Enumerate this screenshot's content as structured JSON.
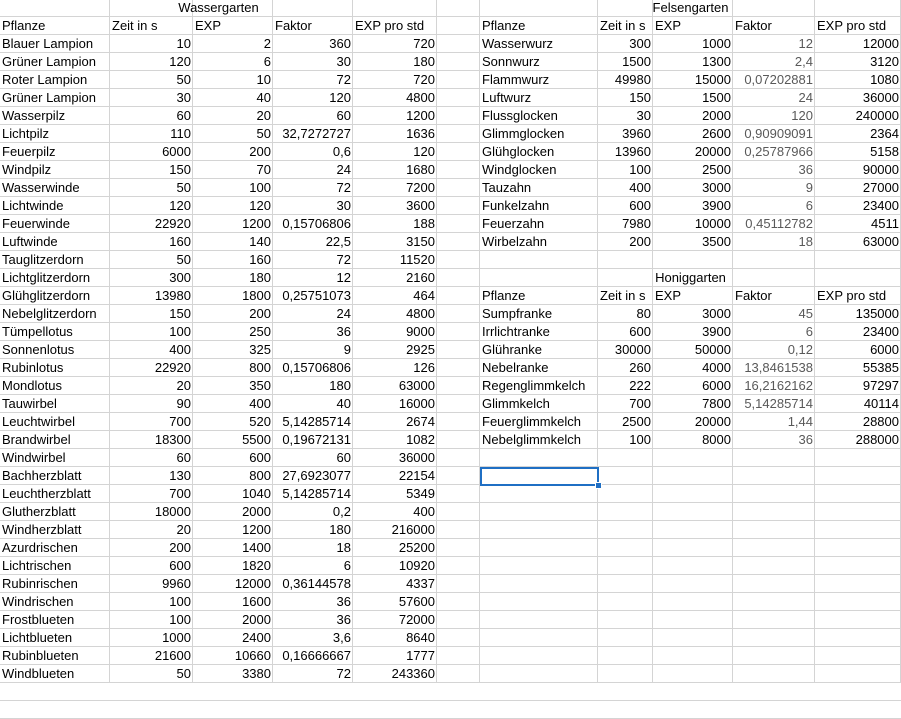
{
  "wassergarten": {
    "title": "Wassergarten",
    "headers": [
      "Pflanze",
      "Zeit in s",
      "EXP",
      "Faktor",
      "EXP pro std"
    ],
    "rows": [
      [
        "Blauer Lampion",
        "10",
        "2",
        "360",
        "720"
      ],
      [
        "Grüner Lampion",
        "120",
        "6",
        "30",
        "180"
      ],
      [
        "Roter Lampion",
        "50",
        "10",
        "72",
        "720"
      ],
      [
        "Grüner Lampion",
        "30",
        "40",
        "120",
        "4800"
      ],
      [
        "Wasserpilz",
        "60",
        "20",
        "60",
        "1200"
      ],
      [
        "Lichtpilz",
        "110",
        "50",
        "32,7272727",
        "1636"
      ],
      [
        "Feuerpilz",
        "6000",
        "200",
        "0,6",
        "120"
      ],
      [
        "Windpilz",
        "150",
        "70",
        "24",
        "1680"
      ],
      [
        "Wasserwinde",
        "50",
        "100",
        "72",
        "7200"
      ],
      [
        "Lichtwinde",
        "120",
        "120",
        "30",
        "3600"
      ],
      [
        "Feuerwinde",
        "22920",
        "1200",
        "0,15706806",
        "188"
      ],
      [
        "Luftwinde",
        "160",
        "140",
        "22,5",
        "3150"
      ],
      [
        "Tauglitzerdorn",
        "50",
        "160",
        "72",
        "11520"
      ],
      [
        "Lichtglitzerdorn",
        "300",
        "180",
        "12",
        "2160"
      ],
      [
        "Glühglitzerdorn",
        "13980",
        "1800",
        "0,25751073",
        "464"
      ],
      [
        "Nebelglitzerdorn",
        "150",
        "200",
        "24",
        "4800"
      ],
      [
        "Tümpellotus",
        "100",
        "250",
        "36",
        "9000"
      ],
      [
        "Sonnenlotus",
        "400",
        "325",
        "9",
        "2925"
      ],
      [
        "Rubinlotus",
        "22920",
        "800",
        "0,15706806",
        "126"
      ],
      [
        "Mondlotus",
        "20",
        "350",
        "180",
        "63000"
      ],
      [
        "Tauwirbel",
        "90",
        "400",
        "40",
        "16000"
      ],
      [
        "Leuchtwirbel",
        "700",
        "520",
        "5,14285714",
        "2674"
      ],
      [
        "Brandwirbel",
        "18300",
        "5500",
        "0,19672131",
        "1082"
      ],
      [
        "Windwirbel",
        "60",
        "600",
        "60",
        "36000"
      ],
      [
        "Bachherzblatt",
        "130",
        "800",
        "27,6923077",
        "22154"
      ],
      [
        "Leuchtherzblatt",
        "700",
        "1040",
        "5,14285714",
        "5349"
      ],
      [
        "Glutherzblatt",
        "18000",
        "2000",
        "0,2",
        "400"
      ],
      [
        "Windherzblatt",
        "20",
        "1200",
        "180",
        "216000"
      ],
      [
        "Azurdrischen",
        "200",
        "1400",
        "18",
        "25200"
      ],
      [
        "Lichtrischen",
        "600",
        "1820",
        "6",
        "10920"
      ],
      [
        "Rubinrischen",
        "9960",
        "12000",
        "0,36144578",
        "4337"
      ],
      [
        "Windrischen",
        "100",
        "1600",
        "36",
        "57600"
      ],
      [
        "Frostblueten",
        "100",
        "2000",
        "36",
        "72000"
      ],
      [
        "Lichtblueten",
        "1000",
        "2400",
        "3,6",
        "8640"
      ],
      [
        "Rubinblueten",
        "21600",
        "10660",
        "0,16666667",
        "1777"
      ],
      [
        "Windblueten",
        "50",
        "3380",
        "72",
        "243360"
      ]
    ]
  },
  "felsengarten": {
    "title": "Felsengarten",
    "headers": [
      "Pflanze",
      "Zeit in s",
      "EXP",
      "Faktor",
      "EXP pro std"
    ],
    "rows": [
      [
        "Wasserwurz",
        "300",
        "1000",
        "12",
        "12000"
      ],
      [
        "Sonnwurz",
        "1500",
        "1300",
        "2,4",
        "3120"
      ],
      [
        "Flammwurz",
        "49980",
        "15000",
        "0,07202881",
        "1080"
      ],
      [
        "Luftwurz",
        "150",
        "1500",
        "24",
        "36000"
      ],
      [
        "Flussglocken",
        "30",
        "2000",
        "120",
        "240000"
      ],
      [
        "Glimmglocken",
        "3960",
        "2600",
        "0,90909091",
        "2364"
      ],
      [
        "Glühglocken",
        "13960",
        "20000",
        "0,25787966",
        "5158"
      ],
      [
        "Windglocken",
        "100",
        "2500",
        "36",
        "90000"
      ],
      [
        "Tauzahn",
        "400",
        "3000",
        "9",
        "27000"
      ],
      [
        "Funkelzahn",
        "600",
        "3900",
        "6",
        "23400"
      ],
      [
        "Feuerzahn",
        "7980",
        "10000",
        "0,45112782",
        "4511"
      ],
      [
        "Wirbelzahn",
        "200",
        "3500",
        "18",
        "63000"
      ]
    ]
  },
  "honiggarten": {
    "title": "Honiggarten",
    "headers": [
      "Pflanze",
      "Zeit in s",
      "EXP",
      "Faktor",
      "EXP pro std"
    ],
    "rows": [
      [
        "Sumpfranke",
        "80",
        "3000",
        "45",
        "135000"
      ],
      [
        "Irrlichtranke",
        "600",
        "3900",
        "6",
        "23400"
      ],
      [
        "Glühranke",
        "30000",
        "50000",
        "0,12",
        "6000"
      ],
      [
        "Nebelranke",
        "260",
        "4000",
        "13,8461538",
        "55385"
      ],
      [
        "Regenglimmkelch",
        "222",
        "6000",
        "16,2162162",
        "97297"
      ],
      [
        "Glimmkelch",
        "700",
        "7800",
        "5,14285714",
        "40114"
      ],
      [
        "Feuerglimmkelch",
        "2500",
        "20000",
        "1,44",
        "28800"
      ],
      [
        "Nebelglimmkelch",
        "100",
        "8000",
        "36",
        "288000"
      ]
    ]
  }
}
